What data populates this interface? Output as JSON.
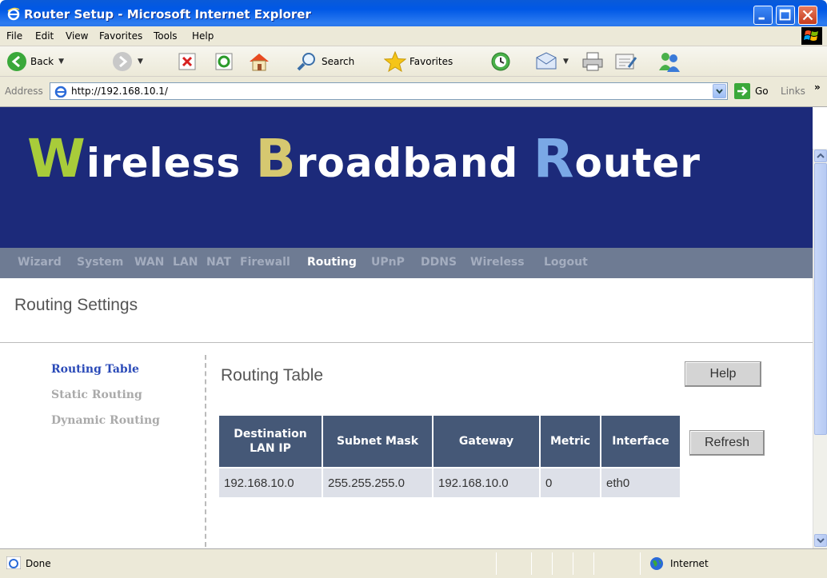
{
  "window": {
    "title": "Router Setup - Microsoft Internet Explorer"
  },
  "menu": {
    "items": [
      "File",
      "Edit",
      "View",
      "Favorites",
      "Tools",
      "Help"
    ]
  },
  "toolbar": {
    "back_label": "Back",
    "search_label": "Search",
    "favorites_label": "Favorites"
  },
  "address": {
    "label": "Address",
    "url": "http://192.168.10.1/",
    "go_label": "Go",
    "links_label": "Links",
    "more_label": "»"
  },
  "page": {
    "banner": {
      "w_cap": "W",
      "w_rest": "ireless ",
      "b_cap": "B",
      "b_rest": "roadband ",
      "r_cap": "R",
      "r_rest": "outer"
    },
    "nav": {
      "items": [
        "Wizard",
        "System",
        "WAN",
        "LAN",
        "NAT",
        "Firewall",
        "Routing",
        "UPnP",
        "DDNS",
        "Wireless",
        "Logout"
      ],
      "active": "Routing"
    },
    "section_title": "Routing Settings",
    "sidebar": {
      "links": [
        "Routing Table",
        "Static Routing",
        "Dynamic Routing"
      ],
      "active": "Routing Table"
    },
    "table_title": "Routing Table",
    "help_label": "Help",
    "refresh_label": "Refresh",
    "table": {
      "headers": [
        [
          "Destination",
          "LAN IP"
        ],
        [
          "Subnet Mask"
        ],
        [
          "Gateway"
        ],
        [
          "Metric"
        ],
        [
          "Interface"
        ]
      ],
      "rows": [
        [
          "192.168.10.0",
          "255.255.255.0",
          "192.168.10.0",
          "0",
          "eth0"
        ]
      ]
    }
  },
  "status": {
    "text": "Done",
    "zone": "Internet"
  },
  "colors": {
    "banner_bg": "#1c2a7a",
    "nav_bg": "#6e7b93",
    "header_bg": "#455877",
    "cell_bg": "#dde0e8",
    "accent_w": "#a8cc3a",
    "accent_b": "#d6c870",
    "accent_r": "#7aa8e6"
  }
}
